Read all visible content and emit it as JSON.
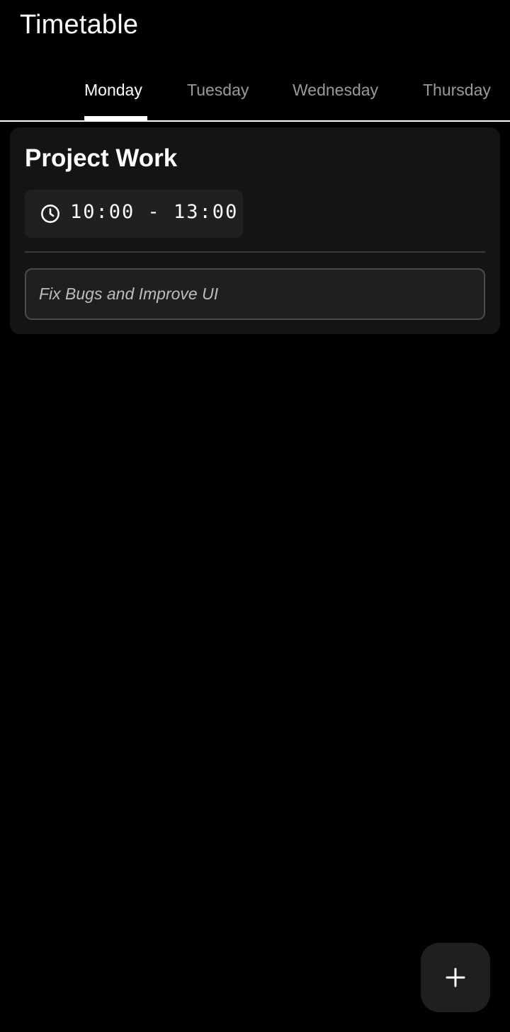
{
  "app": {
    "title": "Timetable"
  },
  "tabs": [
    {
      "label": "Monday",
      "active": true
    },
    {
      "label": "Tuesday",
      "active": false
    },
    {
      "label": "Wednesday",
      "active": false
    },
    {
      "label": "Thursday",
      "active": false
    }
  ],
  "entries": [
    {
      "title": "Project Work",
      "time": "10:00 - 13:00",
      "note": "Fix Bugs and Improve UI"
    }
  ],
  "icons": {
    "clock": "clock-icon",
    "add": "plus-icon"
  },
  "colors": {
    "background": "#000000",
    "card": "#141414",
    "chip": "#202020",
    "inactive_tab": "#9a9a9a",
    "active_tab": "#ffffff"
  }
}
